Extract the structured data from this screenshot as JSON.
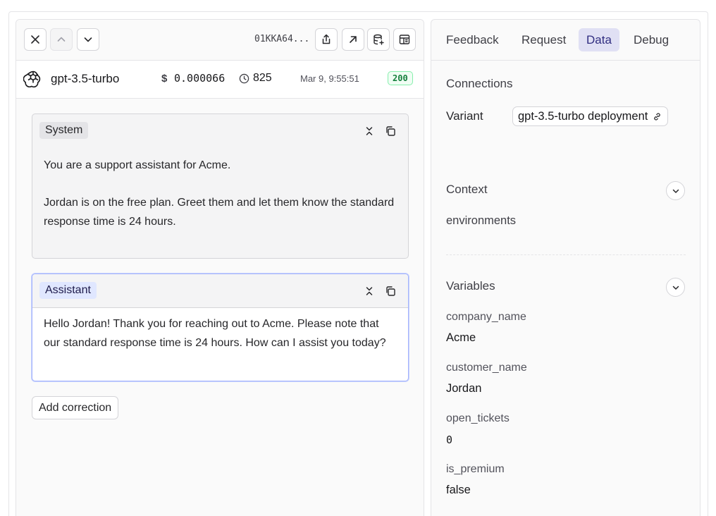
{
  "toolbar": {
    "trace_id": "01KKA64..."
  },
  "meta": {
    "model": "gpt-3.5-turbo",
    "cost_symbol": "$",
    "cost": "0.000066",
    "tokens": "825",
    "timestamp": "Mar 9, 9:55:51",
    "status": "200"
  },
  "messages": [
    {
      "role": "System",
      "content": "You are a support assistant for Acme.\n\nJordan is on the free plan. Greet them and let them know the standard response time is 24 hours."
    },
    {
      "role": "Assistant",
      "content": "Hello Jordan! Thank you for reaching out to Acme. Please note that our standard response time is 24 hours. How can I assist you today?"
    }
  ],
  "add_correction_label": "Add correction",
  "tabs": [
    {
      "label": "Feedback",
      "active": false
    },
    {
      "label": "Request",
      "active": false
    },
    {
      "label": "Data",
      "active": true
    },
    {
      "label": "Debug",
      "active": false
    }
  ],
  "connections": {
    "title": "Connections",
    "variant_label": "Variant",
    "variant_value": "gpt-3.5-turbo deployment"
  },
  "context": {
    "title": "Context",
    "items": [
      "environments"
    ]
  },
  "variables": {
    "title": "Variables",
    "items": [
      {
        "name": "company_name",
        "value": "Acme"
      },
      {
        "name": "customer_name",
        "value": "Jordan"
      },
      {
        "name": "open_tickets",
        "value": "0"
      },
      {
        "name": "is_premium",
        "value": "false"
      }
    ]
  },
  "colors": {
    "accent": "#e0e0f4",
    "status_green": "#15803d"
  }
}
